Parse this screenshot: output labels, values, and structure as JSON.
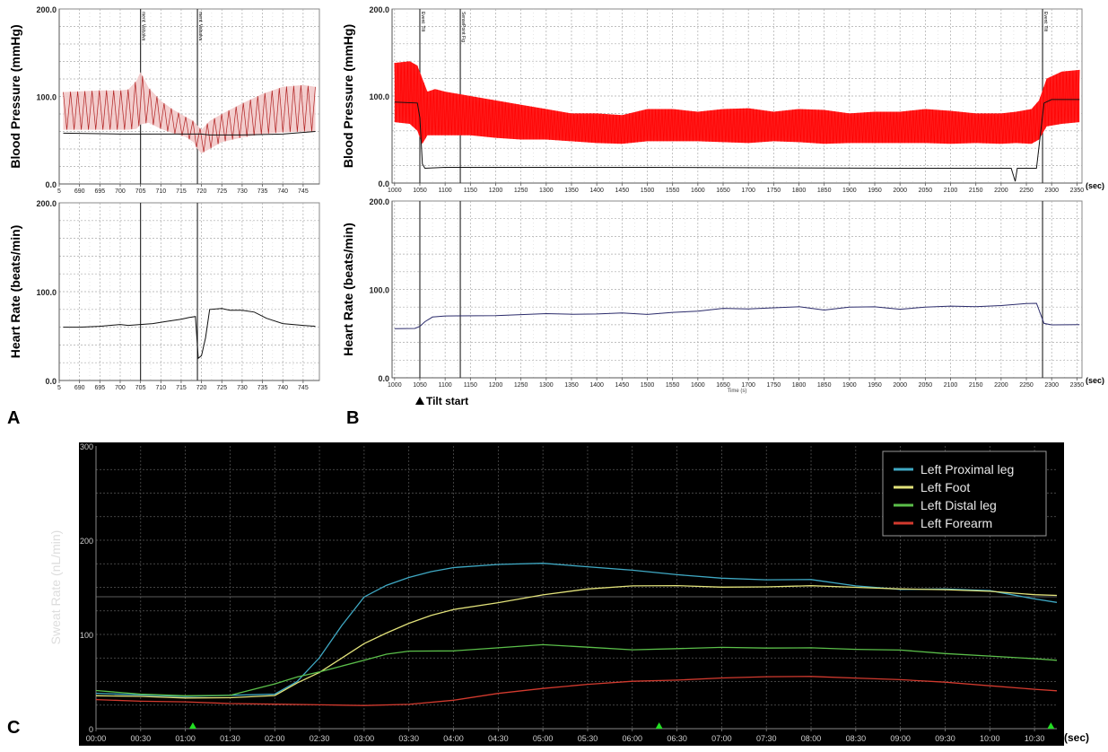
{
  "panels": {
    "a_label": "A",
    "b_label": "B",
    "c_label": "C"
  },
  "chart_data": [
    {
      "id": "A-bp",
      "type": "line",
      "ylabel": "Blood Pressure (mmHg)",
      "xlabel": "",
      "ylim": [
        0,
        200
      ],
      "yticks": [
        "0.0",
        "100.0",
        "200.0"
      ],
      "xlim": [
        685,
        749
      ],
      "xticks": [
        "5",
        "690",
        "695",
        "700",
        "705",
        "710",
        "715",
        "720",
        "725",
        "730",
        "735",
        "740",
        "745"
      ],
      "xtick_values": [
        685,
        690,
        695,
        700,
        705,
        710,
        715,
        720,
        725,
        730,
        735,
        740,
        745
      ],
      "event_markers": [
        {
          "x": 705,
          "label": "ment: Valsalva"
        },
        {
          "x": 719,
          "label": "ment: Valsalva"
        }
      ],
      "grid": true,
      "series": [
        {
          "style": "red-band",
          "x": [
            686,
            695,
            700,
            702,
            704,
            705,
            707,
            710,
            713,
            716,
            718,
            719,
            720,
            722,
            725,
            730,
            735,
            740,
            745,
            748
          ],
          "upper": [
            105,
            107,
            107,
            108,
            118,
            128,
            110,
            95,
            85,
            77,
            72,
            67,
            62,
            72,
            80,
            92,
            103,
            111,
            113,
            111
          ],
          "lower": [
            62,
            62,
            62,
            62,
            63,
            68,
            70,
            63,
            58,
            54,
            48,
            40,
            35,
            40,
            48,
            53,
            57,
            59,
            60,
            60
          ]
        },
        {
          "style": "black-line",
          "x": [
            686,
            700,
            710,
            715,
            719,
            720,
            722,
            730,
            740,
            748
          ],
          "values": [
            58,
            57,
            57,
            57,
            57,
            57,
            56,
            56,
            57,
            60
          ]
        }
      ]
    },
    {
      "id": "A-hr",
      "type": "line",
      "ylabel": "Heart Rate (beats/min)",
      "xlabel": "",
      "ylim": [
        0,
        200
      ],
      "yticks": [
        "0.0",
        "100.0",
        "200.0"
      ],
      "xlim": [
        685,
        749
      ],
      "xticks": [
        "5",
        "690",
        "695",
        "700",
        "705",
        "710",
        "715",
        "720",
        "725",
        "730",
        "735",
        "740",
        "745"
      ],
      "xtick_values": [
        685,
        690,
        695,
        700,
        705,
        710,
        715,
        720,
        725,
        730,
        735,
        740,
        745
      ],
      "event_markers": [
        {
          "x": 705,
          "label": ""
        },
        {
          "x": 719,
          "label": ""
        }
      ],
      "grid": true,
      "series": [
        {
          "style": "black-line",
          "x": [
            686,
            690,
            695,
            700,
            702,
            705,
            708,
            712,
            715,
            717,
            718.5,
            719.2,
            720,
            721,
            722,
            725,
            727,
            730,
            733,
            736,
            740,
            745,
            748
          ],
          "values": [
            60,
            60,
            61,
            63,
            62,
            63,
            64,
            67,
            69,
            71,
            72,
            25,
            28,
            48,
            80,
            81,
            79,
            79,
            77,
            70,
            64,
            62,
            61
          ]
        }
      ]
    },
    {
      "id": "B-bp",
      "type": "line",
      "ylabel": "Blood Pressure (mmHg)",
      "xlabel": "",
      "unit_label": "(sec)",
      "ylim": [
        0,
        200
      ],
      "yticks": [
        "0.0",
        "100.0",
        "200.0"
      ],
      "xlim": [
        995,
        2360
      ],
      "xticks": [
        "1000",
        "1050",
        "1100",
        "1150",
        "1200",
        "1250",
        "1300",
        "1350",
        "1400",
        "1450",
        "1500",
        "1550",
        "1600",
        "1650",
        "1700",
        "1750",
        "1800",
        "1850",
        "1900",
        "1950",
        "2000",
        "2050",
        "2100",
        "2150",
        "2200",
        "2250",
        "2300",
        "2350"
      ],
      "xtick_values": [
        1000,
        1050,
        1100,
        1150,
        1200,
        1250,
        1300,
        1350,
        1400,
        1450,
        1500,
        1550,
        1600,
        1650,
        1700,
        1750,
        1800,
        1850,
        1900,
        1950,
        2000,
        2050,
        2100,
        2150,
        2200,
        2250,
        2300,
        2350
      ],
      "event_markers": [
        {
          "x": 1050,
          "label": "Event: Tilt"
        },
        {
          "x": 1130,
          "label": "SensePoint Fig"
        },
        {
          "x": 2282,
          "label": "Event: Tilt"
        }
      ],
      "grid": true,
      "series": [
        {
          "style": "red-band",
          "x": [
            1000,
            1030,
            1045,
            1055,
            1065,
            1080,
            1100,
            1150,
            1200,
            1250,
            1300,
            1350,
            1400,
            1450,
            1500,
            1550,
            1600,
            1650,
            1700,
            1750,
            1800,
            1850,
            1900,
            1950,
            2000,
            2050,
            2100,
            2150,
            2200,
            2230,
            2260,
            2275,
            2290,
            2320,
            2355
          ],
          "upper": [
            138,
            140,
            135,
            120,
            105,
            108,
            105,
            100,
            95,
            90,
            85,
            80,
            80,
            78,
            85,
            85,
            82,
            85,
            86,
            82,
            85,
            84,
            80,
            82,
            82,
            85,
            83,
            80,
            80,
            82,
            85,
            95,
            120,
            128,
            130
          ],
          "lower": [
            70,
            68,
            60,
            45,
            55,
            55,
            55,
            55,
            52,
            50,
            50,
            48,
            46,
            45,
            48,
            48,
            48,
            47,
            46,
            48,
            47,
            45,
            46,
            46,
            46,
            46,
            45,
            46,
            45,
            46,
            45,
            50,
            65,
            68,
            70
          ]
        },
        {
          "style": "black-line",
          "x": [
            1000,
            1045,
            1050,
            1055,
            1060,
            1100,
            1500,
            2000,
            2220,
            2228,
            2232,
            2240,
            2270,
            2285,
            2300,
            2355
          ],
          "values": [
            93,
            92,
            75,
            22,
            17,
            18,
            18,
            17,
            17,
            2,
            17,
            17,
            17,
            92,
            96,
            96
          ]
        }
      ]
    },
    {
      "id": "B-hr",
      "type": "line",
      "ylabel": "Heart Rate (beats/min)",
      "xlabel": "Time (s)",
      "unit_label": "(sec)",
      "annotation": "Tilt start",
      "annotation_x": 1050,
      "ylim": [
        0,
        200
      ],
      "yticks": [
        "0.0",
        "100.0",
        "200.0"
      ],
      "xlim": [
        995,
        2360
      ],
      "xticks": [
        "1000",
        "1050",
        "1100",
        "1150",
        "1200",
        "1250",
        "1300",
        "1350",
        "1400",
        "1450",
        "1500",
        "1550",
        "1600",
        "1650",
        "1700",
        "1750",
        "1800",
        "1850",
        "1900",
        "1950",
        "2000",
        "2050",
        "2100",
        "2150",
        "2200",
        "2250",
        "2300",
        "2350"
      ],
      "xtick_values": [
        1000,
        1050,
        1100,
        1150,
        1200,
        1250,
        1300,
        1350,
        1400,
        1450,
        1500,
        1550,
        1600,
        1650,
        1700,
        1750,
        1800,
        1850,
        1900,
        1950,
        2000,
        2050,
        2100,
        2150,
        2200,
        2250,
        2300,
        2350
      ],
      "event_markers": [
        {
          "x": 1050,
          "label": ""
        },
        {
          "x": 1130,
          "label": ""
        },
        {
          "x": 2282,
          "label": ""
        }
      ],
      "grid": true,
      "series": [
        {
          "style": "navy-line",
          "x": [
            1000,
            1040,
            1050,
            1060,
            1075,
            1100,
            1200,
            1300,
            1350,
            1400,
            1450,
            1500,
            1550,
            1600,
            1650,
            1700,
            1750,
            1800,
            1850,
            1900,
            1950,
            2000,
            2050,
            2100,
            2150,
            2200,
            2250,
            2270,
            2285,
            2300,
            2355
          ],
          "values": [
            56,
            56,
            58,
            63,
            69,
            70,
            70,
            73,
            72,
            72,
            73,
            72,
            74,
            75,
            79,
            78,
            79,
            80,
            77,
            80,
            80,
            78,
            80,
            81,
            80,
            82,
            84,
            84,
            62,
            60,
            60
          ]
        }
      ]
    },
    {
      "id": "C-sweat",
      "type": "line",
      "ylabel": "Sweat Rate (nL/min)",
      "xlabel": "",
      "unit_label": "(sec)",
      "ylim": [
        0,
        300
      ],
      "yticks": [
        "0",
        "100",
        "200",
        "300"
      ],
      "xlim": [
        0,
        645
      ],
      "xticks": [
        "00:00",
        "00:30",
        "01:00",
        "01:30",
        "02:00",
        "02:30",
        "03:00",
        "03:30",
        "04:00",
        "04:30",
        "05:00",
        "05:30",
        "06:00",
        "06:30",
        "07:00",
        "07:30",
        "08:00",
        "08:30",
        "09:00",
        "09:30",
        "10:00",
        "10:30"
      ],
      "xtick_values": [
        0,
        30,
        60,
        90,
        120,
        150,
        180,
        210,
        240,
        270,
        300,
        330,
        360,
        390,
        420,
        450,
        480,
        510,
        540,
        570,
        600,
        630
      ],
      "hline": 140,
      "markers_x": [
        65,
        378,
        641
      ],
      "legend_position": "top-right",
      "grid": true,
      "series": [
        {
          "name": "Left Proximal leg",
          "color": "#3fa9c4",
          "x": [
            0,
            30,
            60,
            90,
            120,
            135,
            150,
            165,
            180,
            195,
            210,
            225,
            240,
            270,
            300,
            330,
            360,
            390,
            420,
            450,
            480,
            510,
            540,
            570,
            600,
            630,
            645
          ],
          "values": [
            38,
            36,
            34,
            35,
            37,
            50,
            75,
            110,
            140,
            152,
            160,
            167,
            171,
            174,
            176,
            172,
            168,
            163,
            160,
            158,
            158,
            152,
            148,
            148,
            146,
            138,
            134
          ]
        },
        {
          "name": "Left Foot",
          "color": "#e2e27a",
          "x": [
            0,
            30,
            60,
            90,
            120,
            135,
            150,
            165,
            180,
            195,
            210,
            225,
            240,
            270,
            300,
            330,
            360,
            390,
            420,
            450,
            480,
            510,
            540,
            570,
            600,
            630,
            645
          ],
          "values": [
            35,
            34,
            33,
            33,
            35,
            48,
            60,
            75,
            90,
            102,
            112,
            120,
            126,
            134,
            142,
            148,
            152,
            152,
            150,
            150,
            152,
            150,
            148,
            148,
            146,
            142,
            141
          ]
        },
        {
          "name": "Left Distal leg",
          "color": "#5bbf4a",
          "x": [
            0,
            30,
            60,
            90,
            120,
            135,
            150,
            165,
            180,
            195,
            210,
            240,
            270,
            300,
            330,
            360,
            390,
            420,
            450,
            480,
            510,
            540,
            570,
            600,
            630,
            645
          ],
          "values": [
            40,
            37,
            35,
            35,
            48,
            55,
            60,
            66,
            73,
            79,
            82,
            83,
            86,
            89,
            86,
            84,
            85,
            86,
            86,
            86,
            84,
            83,
            80,
            77,
            74,
            73
          ]
        },
        {
          "name": "Left Forearm",
          "color": "#d23a2e",
          "x": [
            0,
            30,
            60,
            90,
            120,
            150,
            180,
            210,
            240,
            270,
            300,
            330,
            360,
            390,
            420,
            450,
            480,
            510,
            540,
            570,
            600,
            630,
            645
          ],
          "values": [
            31,
            29,
            28,
            27,
            26,
            25,
            25,
            26,
            30,
            37,
            43,
            47,
            50,
            52,
            54,
            55,
            55,
            54,
            52,
            49,
            46,
            42,
            40
          ]
        }
      ]
    }
  ]
}
